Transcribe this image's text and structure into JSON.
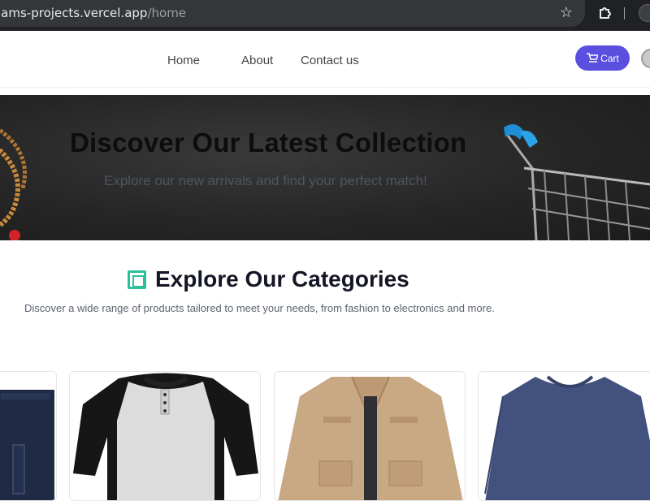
{
  "browser": {
    "url_host": "aslams-projects.vercel.app",
    "url_path": "/home"
  },
  "nav": {
    "links": [
      "Home",
      "About",
      "Contact us"
    ],
    "cart_label": "Cart"
  },
  "hero": {
    "title": "Discover Our Latest Collection",
    "subtitle": "Explore our new arrivals and find your perfect match!"
  },
  "categories": {
    "title": "Explore Our Categories",
    "subtitle": "Discover a wide range of products tailored to meet your needs, from fashion to electronics and more."
  },
  "colors": {
    "accent": "#5b4fe0",
    "icon_teal": "#2bbf9a",
    "hero_bg": "#262626"
  },
  "products": [
    {
      "icon": "jeans-image"
    },
    {
      "icon": "henley-shirt-image"
    },
    {
      "icon": "jacket-image"
    },
    {
      "icon": "sweater-image"
    }
  ]
}
